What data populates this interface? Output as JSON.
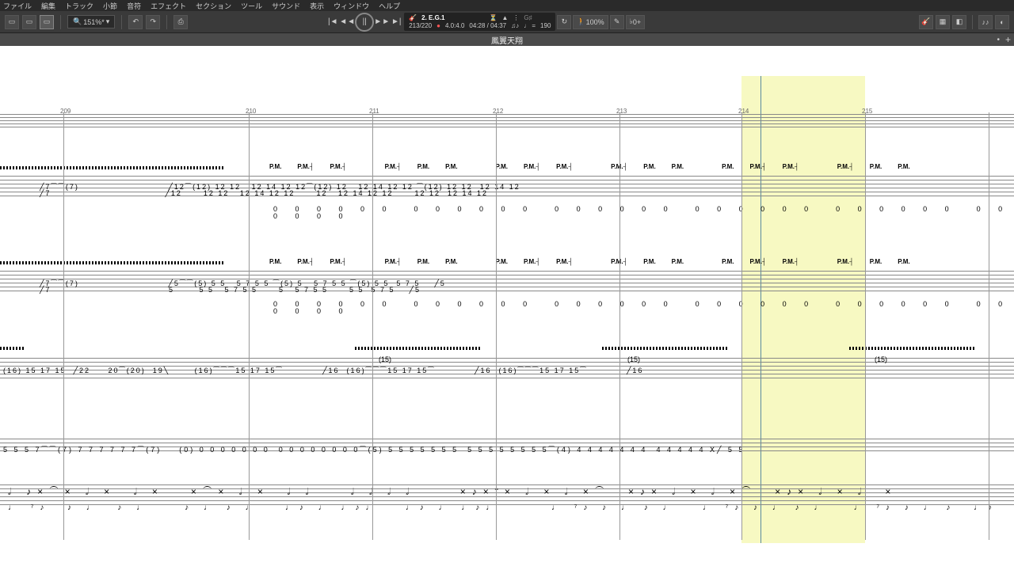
{
  "menu": {
    "items": [
      "ファイル",
      "編集",
      "トラック",
      "小節",
      "音符",
      "エフェクト",
      "セクション",
      "ツール",
      "サウンド",
      "表示",
      "ウィンドウ",
      "ヘルプ"
    ]
  },
  "toolbar": {
    "zoom": "151%*"
  },
  "transport": {
    "track": "2. E.G.1",
    "bars": "213/220",
    "sig": "4.0:4.0",
    "time": "04:28 / 04:37",
    "tempo_label": "♩ =",
    "tempo": "190",
    "speed": "100%",
    "count": "0"
  },
  "tab": {
    "title": "鳳翼天翔"
  },
  "barNumbers": [
    209,
    210,
    211,
    212,
    213,
    214,
    215
  ],
  "barPositions": [
    80,
    314,
    470,
    626,
    782,
    936,
    1092,
    1248
  ],
  "pm": {
    "labels": [
      "P.M.",
      "P.M.┤",
      "P.M.┤"
    ],
    "labels2": [
      "P.M.┤",
      "P.M.",
      "P.M."
    ]
  },
  "staff1": {
    "top_frets": [
      "7",
      "7",
      "(7)",
      "12",
      "12",
      "(12)",
      "12",
      "12",
      "12",
      "12",
      "12",
      "14",
      "12",
      "12",
      "(12)",
      "12",
      "12",
      "12",
      "14",
      "12",
      "12",
      "12",
      "14",
      "12",
      "12"
    ],
    "zeros": "0 0  0 0  0 0"
  },
  "staff2": {
    "top_frets": [
      "7",
      "7",
      "(7)",
      "5",
      "5",
      "(5)",
      "5",
      "5",
      "5",
      "5",
      "5",
      "7",
      "5",
      "5",
      "(5)",
      "5",
      "5",
      "5",
      "7",
      "5",
      "5",
      "5",
      "7",
      "5",
      "5"
    ]
  },
  "staff3": {
    "frets": [
      "(16)",
      "15",
      "17",
      "15",
      "22",
      "20",
      "(20)",
      "19",
      "(16)",
      "15",
      "17",
      "15",
      "(15)",
      "16",
      "(16)",
      "15",
      "17",
      "15",
      "(15)",
      "16",
      "(16)",
      "15",
      "17",
      "15",
      "(15)",
      "16"
    ]
  },
  "staff4": {
    "frets": [
      "5",
      "5",
      "5",
      "7",
      "(7)",
      "7",
      "7",
      "7",
      "7",
      "7",
      "7",
      "(7)",
      "(0)",
      "0",
      "0",
      "0",
      "0",
      "0",
      "0",
      "0",
      "0",
      "0",
      "0",
      "0",
      "0",
      "0",
      "(5)",
      "5",
      "5",
      "5",
      "5",
      "5",
      "5",
      "5",
      "5",
      "5",
      "5",
      "5",
      "5",
      "5",
      "(4)",
      "4",
      "4",
      "4",
      "4",
      "4",
      "4",
      "4",
      "4",
      "4",
      "4",
      "4",
      "X",
      "5",
      "5"
    ]
  }
}
